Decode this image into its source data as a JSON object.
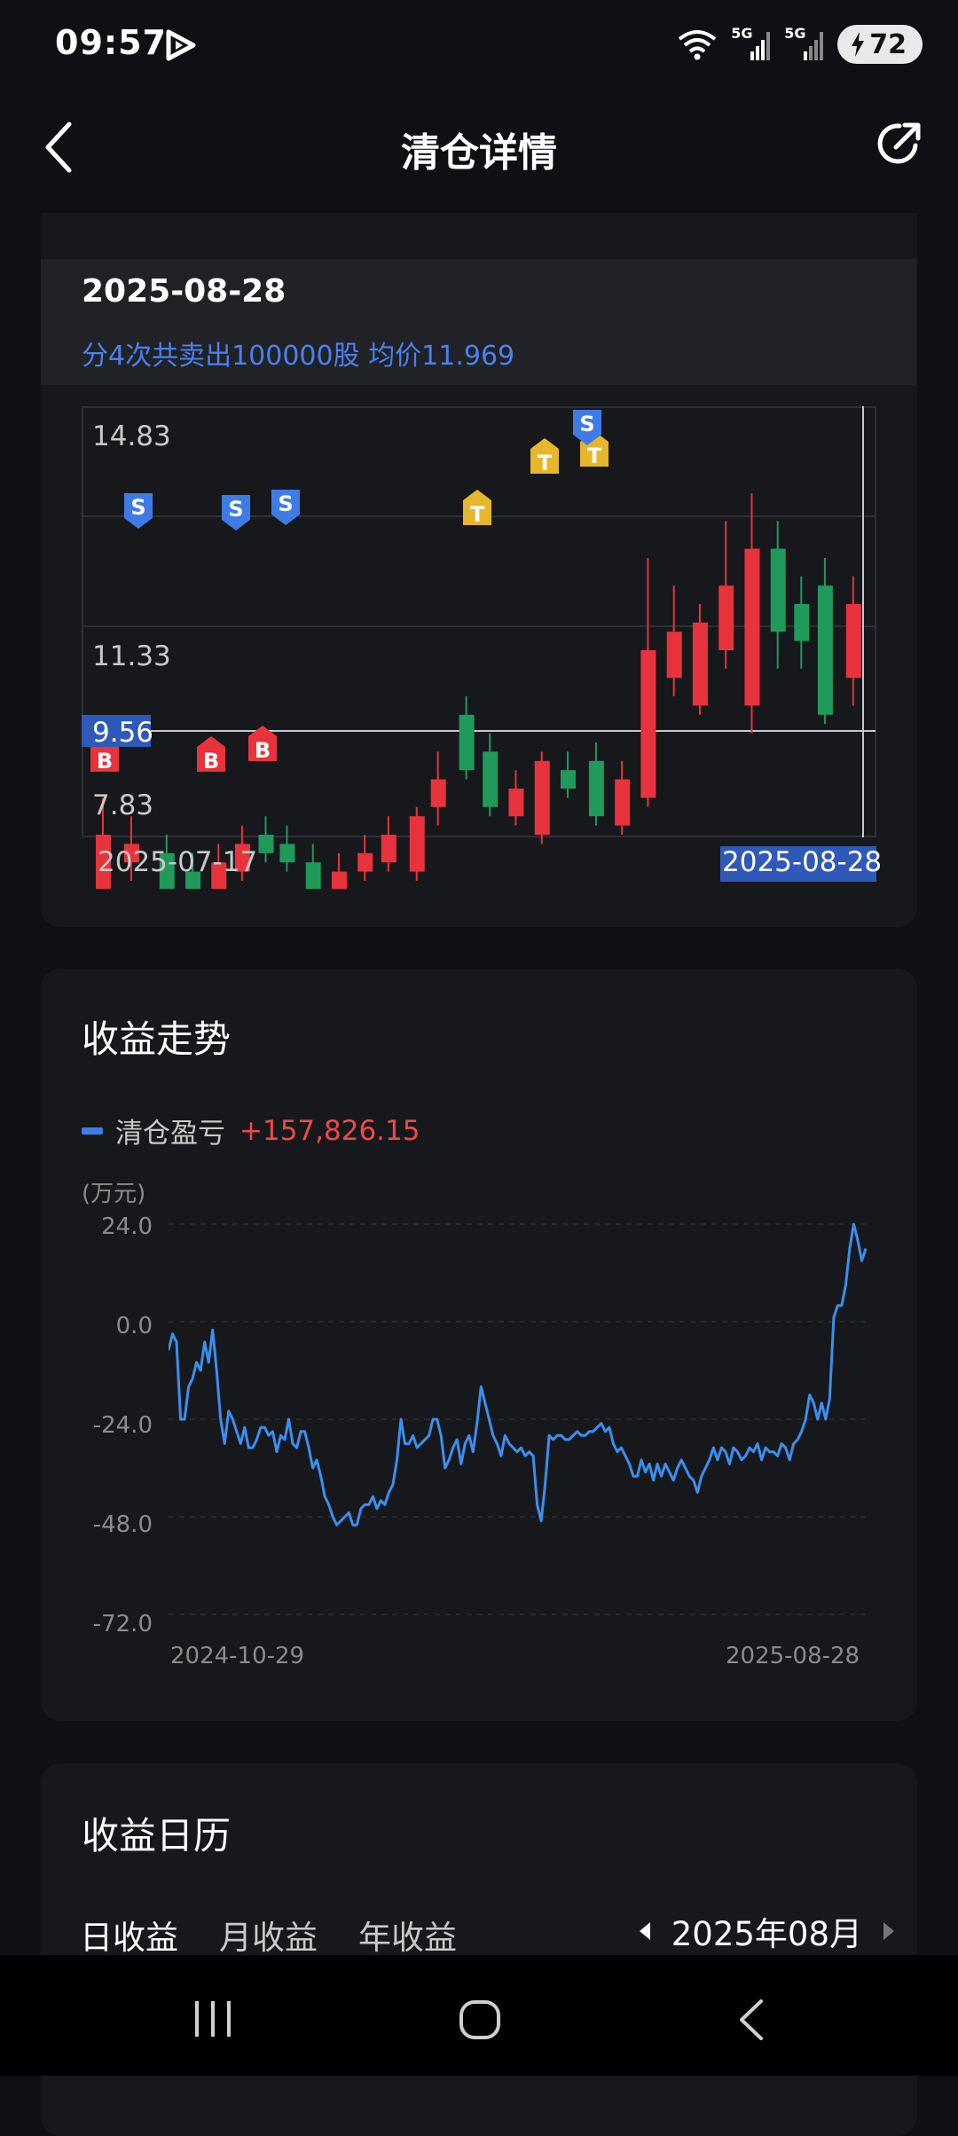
{
  "status_bar": {
    "time": "09:57",
    "battery": "72",
    "net1": "5G",
    "net2": "5G"
  },
  "header": {
    "title": "清仓详情"
  },
  "trade": {
    "date": "2025-08-28",
    "summary": "分4次共卖出100000股 均价11.969"
  },
  "kline": {
    "y_labels": [
      "14.83",
      "11.33",
      "7.83"
    ],
    "current_price": "9.56",
    "x_start": "2025-07-17",
    "x_end": "2025-08-28",
    "marker_labels": {
      "buy": "B",
      "sell": "S",
      "t": "T"
    },
    "colors": {
      "up": "#e8333c",
      "down": "#1f9a5a",
      "buy": "#e8333c",
      "sell": "#3f7be6",
      "t": "#e8b62c"
    }
  },
  "profit_trend": {
    "title": "收益走势",
    "legend_label": "清仓盈亏",
    "legend_value": "+157,826.15",
    "unit": "(万元)",
    "line_color": "#3a8ff0"
  },
  "chart_data": {
    "type": "line",
    "title": "收益走势",
    "ylabel": "(万元)",
    "y_ticks": [
      "24.0",
      "0.0",
      "-24.0",
      "-48.0",
      "-72.0"
    ],
    "ylim": [
      -72,
      24
    ],
    "x_ticks": [
      "2024-10-29",
      "2025-08-28"
    ],
    "series": [
      {
        "name": "清仓盈亏",
        "values": [
          -7,
          -3,
          -5,
          -24,
          -24,
          -16,
          -14,
          -10,
          -12,
          -5,
          -10,
          -2,
          -12,
          -24,
          -30,
          -22,
          -24,
          -27,
          -30,
          -26,
          -31,
          -31,
          -29,
          -26,
          -26,
          -28,
          -27,
          -32,
          -28,
          -29,
          -24,
          -30,
          -31,
          -27,
          -27,
          -31,
          -36,
          -34,
          -38,
          -43,
          -45,
          -48,
          -50,
          -49,
          -48,
          -47,
          -50,
          -50,
          -46,
          -45,
          -45,
          -43,
          -46,
          -44,
          -45,
          -42,
          -40,
          -34,
          -24,
          -30,
          -30,
          -28,
          -31,
          -30,
          -29,
          -28,
          -24,
          -24,
          -28,
          -36,
          -34,
          -31,
          -29,
          -35,
          -30,
          -28,
          -32,
          -25,
          -16,
          -20,
          -24,
          -28,
          -30,
          -33,
          -28,
          -30,
          -31,
          -32,
          -31,
          -33,
          -32,
          -33,
          -45,
          -49,
          -40,
          -28,
          -29,
          -28,
          -28,
          -29,
          -29,
          -28,
          -27,
          -28,
          -28,
          -27,
          -27,
          -26,
          -25,
          -27,
          -26,
          -30,
          -32,
          -31,
          -33,
          -35,
          -38,
          -38,
          -34,
          -37,
          -35,
          -39,
          -35,
          -38,
          -35,
          -37,
          -39,
          -36,
          -34,
          -36,
          -38,
          -39,
          -42,
          -38,
          -36,
          -34,
          -31,
          -34,
          -31,
          -32,
          -35,
          -31,
          -32,
          -34,
          -33,
          -31,
          -32,
          -30,
          -34,
          -31,
          -32,
          -32,
          -33,
          -30,
          -31,
          -34,
          -30,
          -29,
          -27,
          -24,
          -18,
          -20,
          -24,
          -20,
          -24,
          -19,
          1,
          4,
          4,
          9,
          18,
          24,
          20,
          15,
          18
        ]
      }
    ]
  },
  "calendar": {
    "title": "收益日历",
    "tabs": [
      "日收益",
      "月收益",
      "年收益"
    ],
    "month": "2025年08月"
  }
}
